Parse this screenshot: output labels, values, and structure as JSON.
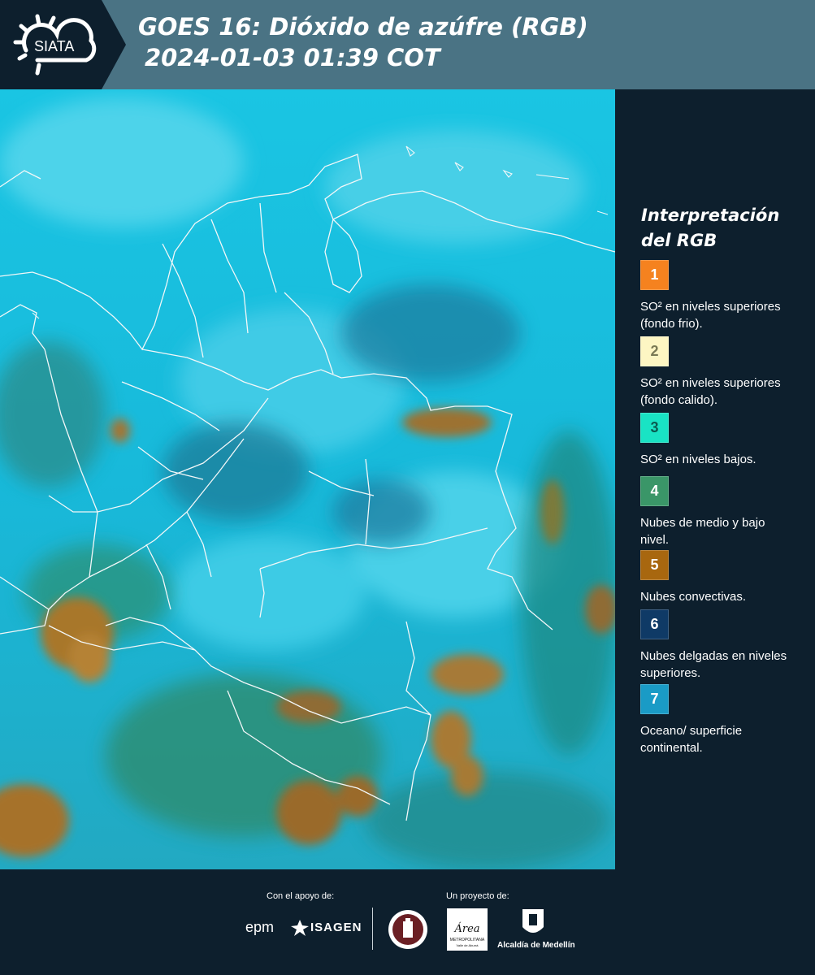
{
  "header": {
    "logo_text": "SIATA",
    "title_line1": "GOES 16: Dióxido de azúfre (RGB)",
    "title_line2": "2024-01-03 01:39 COT"
  },
  "legend": {
    "title_line1": "Interpretación",
    "title_line2": "del RGB",
    "items": [
      {
        "number": "1",
        "color": "#f5821f",
        "number_color": "#ffffff",
        "label": "SO² en niveles superiores (fondo frio)."
      },
      {
        "number": "2",
        "color": "#fdf6c3",
        "number_color": "#7a7a55",
        "label": "SO² en niveles superiores (fondo calido)."
      },
      {
        "number": "3",
        "color": "#19e3c4",
        "number_color": "#0a5a50",
        "label": "SO² en niveles bajos."
      },
      {
        "number": "4",
        "color": "#3a9668",
        "number_color": "#ffffff",
        "label": "Nubes de medio y bajo nivel."
      },
      {
        "number": "5",
        "color": "#a8670f",
        "number_color": "#ffffff",
        "label": "Nubes convectivas."
      },
      {
        "number": "6",
        "color": "#0f3a66",
        "number_color": "#ffffff",
        "label": "Nubes delgadas en niveles superiores."
      },
      {
        "number": "7",
        "color": "#1a9bc6",
        "number_color": "#ffffff",
        "label": "Oceano/ superficie continental."
      }
    ]
  },
  "footer": {
    "support_label": "Con el apoyo de:",
    "project_label": "Un proyecto de:",
    "sponsor_1": "epm",
    "sponsor_2": "ISAGEN",
    "partner_1_text": "Área",
    "partner_1_sub": "METROPOLITANA",
    "partner_1_sub2": "Valle de Aburrá",
    "partner_2": "Alcaldía de Medellín"
  }
}
